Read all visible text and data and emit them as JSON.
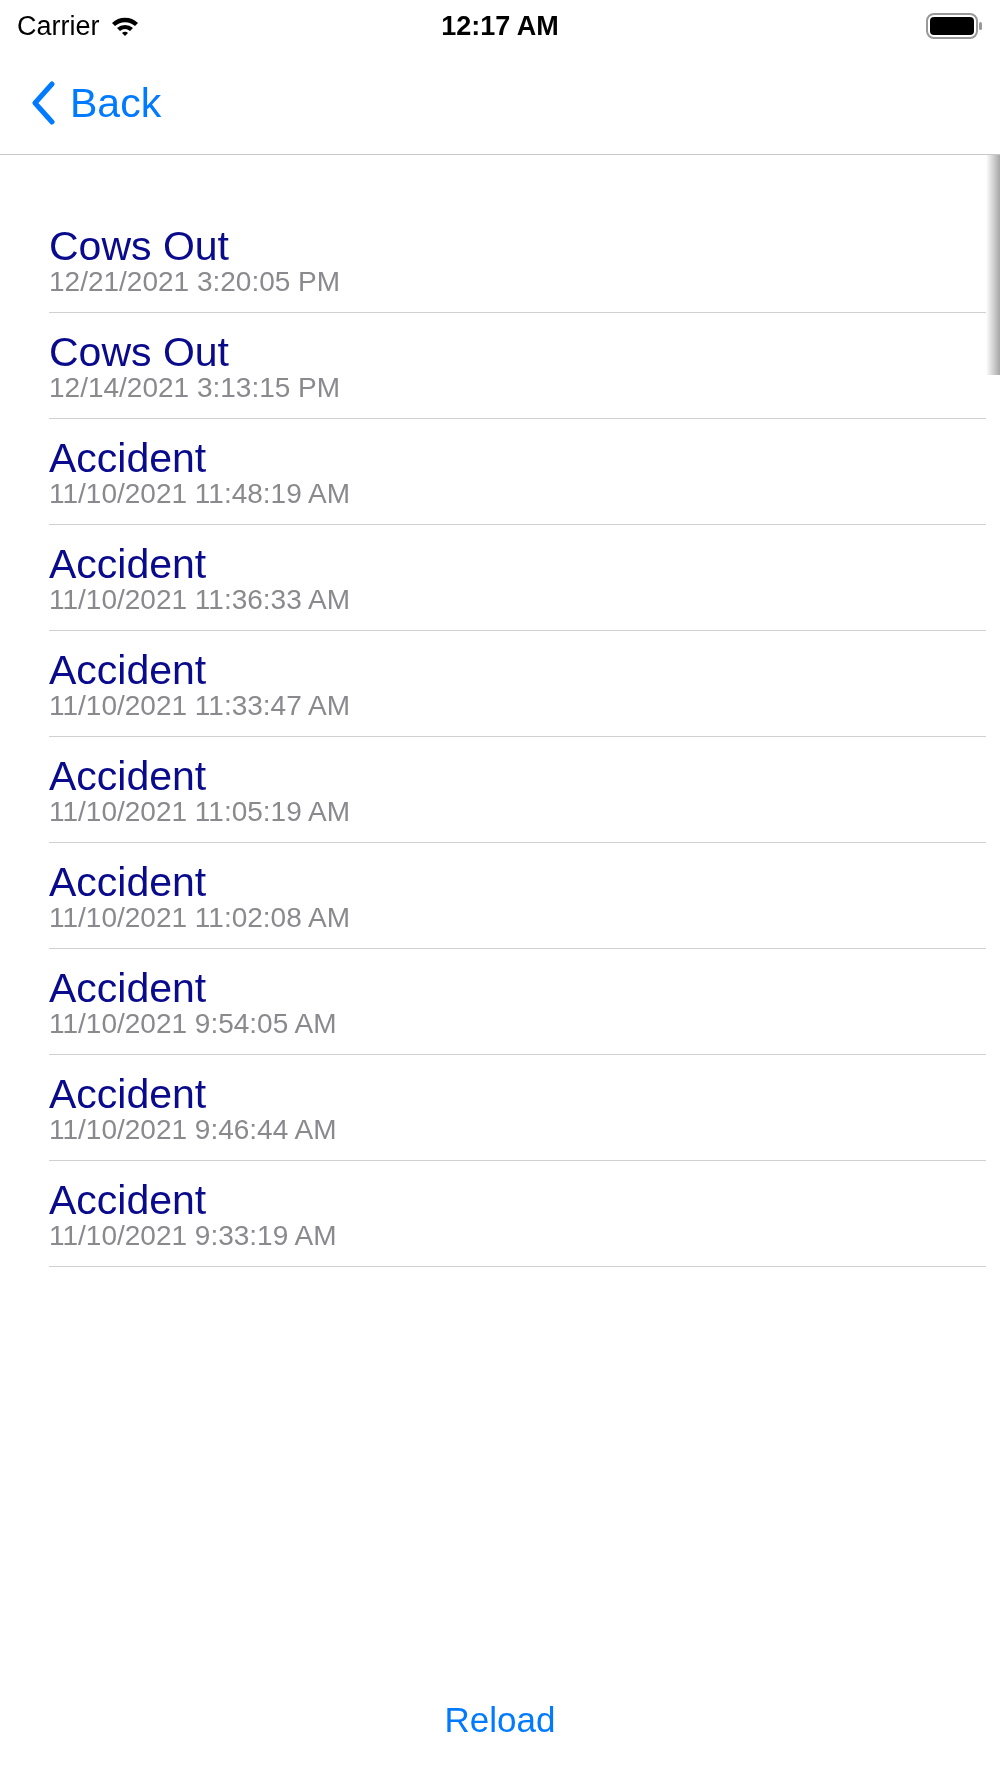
{
  "status_bar": {
    "carrier": "Carrier",
    "time": "12:17 AM"
  },
  "nav": {
    "back": "Back"
  },
  "rows": [
    {
      "title": "Cows Out",
      "date": "12/21/2021 3:20:05 PM"
    },
    {
      "title": "Cows Out",
      "date": "12/14/2021 3:13:15 PM"
    },
    {
      "title": "Accident",
      "date": "11/10/2021 11:48:19 AM"
    },
    {
      "title": "Accident",
      "date": "11/10/2021 11:36:33 AM"
    },
    {
      "title": "Accident",
      "date": "11/10/2021 11:33:47 AM"
    },
    {
      "title": "Accident",
      "date": "11/10/2021 11:05:19 AM"
    },
    {
      "title": "Accident",
      "date": "11/10/2021 11:02:08 AM"
    },
    {
      "title": "Accident",
      "date": "11/10/2021 9:54:05 AM"
    },
    {
      "title": "Accident",
      "date": "11/10/2021 9:46:44 AM"
    },
    {
      "title": "Accident",
      "date": "11/10/2021 9:33:19 AM"
    }
  ],
  "reload": "Reload"
}
